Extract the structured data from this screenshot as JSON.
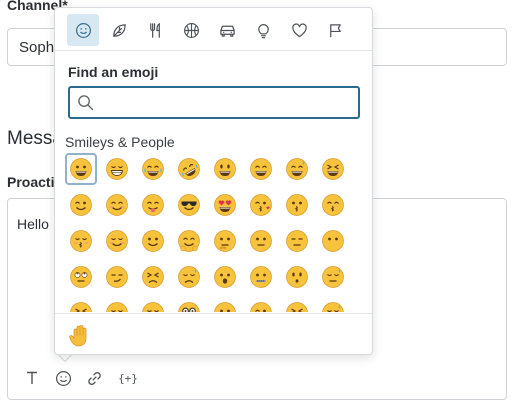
{
  "form": {
    "channel_label": "Channel*",
    "channel_value": "Soph",
    "message_heading": "Messa",
    "proactive_label": "Proacti",
    "message_text": "Hello"
  },
  "toolbar": {
    "buttons": [
      {
        "name": "text-format",
        "icon": "text-format-icon"
      },
      {
        "name": "emoji",
        "icon": "smiley-icon"
      },
      {
        "name": "link",
        "icon": "link-icon"
      },
      {
        "name": "variable",
        "icon": "variable-braces-icon",
        "label": "{+}"
      }
    ]
  },
  "emoji_picker": {
    "categories": [
      {
        "name": "smileys-people",
        "icon": "smiley-icon",
        "selected": true
      },
      {
        "name": "animals-nature",
        "icon": "leaf-icon"
      },
      {
        "name": "food-drink",
        "icon": "fork-knife-icon"
      },
      {
        "name": "activities",
        "icon": "basketball-icon"
      },
      {
        "name": "travel-places",
        "icon": "car-icon"
      },
      {
        "name": "objects",
        "icon": "lightbulb-icon"
      },
      {
        "name": "symbols",
        "icon": "heart-icon"
      },
      {
        "name": "flags",
        "icon": "flag-icon"
      }
    ],
    "search_label": "Find an emoji",
    "search_value": "",
    "search_placeholder": "",
    "section_label": "Smileys & People",
    "emojis": [
      "grinning-face",
      "beaming-face",
      "face-with-tears-of-joy",
      "rolling-on-floor-laughing",
      "grinning-face-big-eyes",
      "grinning-face-smiling-eyes",
      "grinning-face-with-sweat",
      "squinting-face",
      "winking-face",
      "smiling-face",
      "face-savoring-food",
      "smiling-face-with-sunglasses",
      "heart-eyes",
      "face-blowing-kiss",
      "kissing-face",
      "kissing-face-smiling-eyes",
      "kissing-face-closed-eyes",
      "smiling-face-relaxed",
      "slightly-smiling-face",
      "hugging-face",
      "thinking-face",
      "neutral-face",
      "expressionless-face",
      "face-without-mouth",
      "face-with-rolling-eyes",
      "smirking-face",
      "persevering-face",
      "sad-relieved-face",
      "face-with-open-mouth",
      "zipper-mouth-face",
      "hushed-face",
      "sleepy-face",
      "tired-face",
      "sleeping-face",
      "relieved-face",
      "nerd-face",
      "face-with-tongue",
      "winking-face-with-tongue",
      "squinting-face-with-tongue",
      "drooling-face"
    ],
    "skin_tone_icon": "raised-hand-icon",
    "colors": {
      "face": "#f7c23c",
      "face_outline": "#d8962a",
      "focus_ring": "#8fb3cc",
      "search_border": "#2a6b8c",
      "selected_category": "#d8e8f2"
    }
  }
}
